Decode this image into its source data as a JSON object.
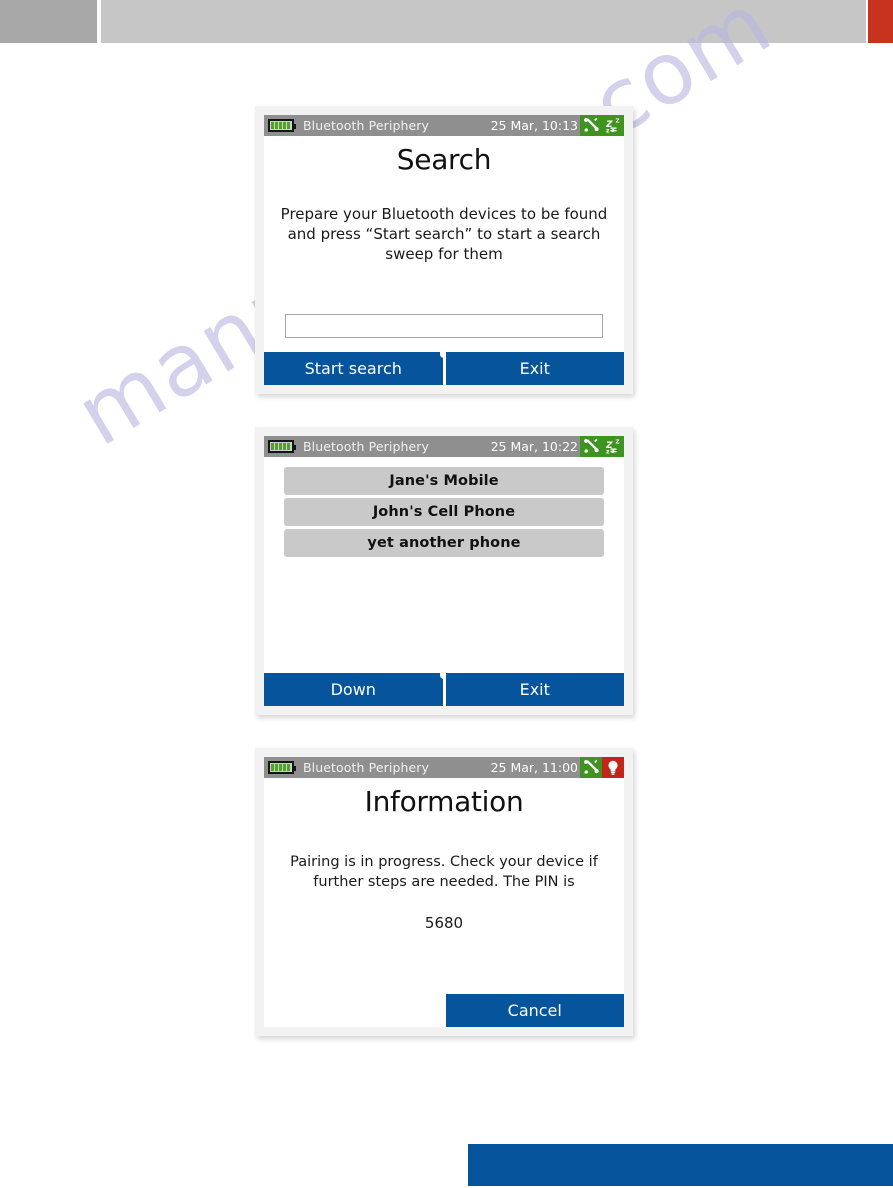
{
  "page": {
    "watermark": "manualshive.com",
    "header_left_color": "#a8a8a8",
    "header_main_color": "#c6c6c6",
    "header_accent_color": "#c8331f",
    "footer_bar_color": "#05549c",
    "accent_blue": "#05549c",
    "status_green": "#3f9421",
    "status_red": "#c4251b"
  },
  "screens": [
    {
      "id": "search",
      "statusbar": {
        "app_title": "Bluetooth Periphery",
        "datetime": "25 Mar, 10:13",
        "battery_bars": 5,
        "icons": [
          {
            "name": "tools-icon",
            "color": "#3f9421"
          },
          {
            "name": "standby-sleep-icon",
            "color": "#3f9421"
          }
        ]
      },
      "title": "Search",
      "paragraph": "Prepare your Bluetooth devices to be found and press “Start search” to start a search sweep for them",
      "textfield_value": "",
      "textfield_placeholder": "",
      "softkeys": [
        {
          "label": "Start search"
        },
        {
          "label": "Exit"
        }
      ]
    },
    {
      "id": "device-list",
      "statusbar": {
        "app_title": "Bluetooth Periphery",
        "datetime": "25 Mar, 10:22",
        "battery_bars": 5,
        "icons": [
          {
            "name": "tools-icon",
            "color": "#3f9421"
          },
          {
            "name": "standby-sleep-icon",
            "color": "#3f9421"
          }
        ]
      },
      "devices": [
        "Jane's Mobile",
        "John's Cell Phone",
        "yet another phone"
      ],
      "softkeys": [
        {
          "label": "Down"
        },
        {
          "label": "Exit"
        }
      ]
    },
    {
      "id": "information",
      "statusbar": {
        "app_title": "Bluetooth Periphery",
        "datetime": "25 Mar, 11:00",
        "battery_bars": 5,
        "icons": [
          {
            "name": "tools-icon",
            "color": "#3f9421"
          },
          {
            "name": "lightbulb-icon",
            "color": "#c4251b"
          }
        ]
      },
      "title": "Information",
      "paragraph": "Pairing is in progress. Check your device if further steps are needed. The PIN is",
      "pin": "5680",
      "softkeys": [
        {
          "label": "Cancel"
        }
      ]
    }
  ]
}
